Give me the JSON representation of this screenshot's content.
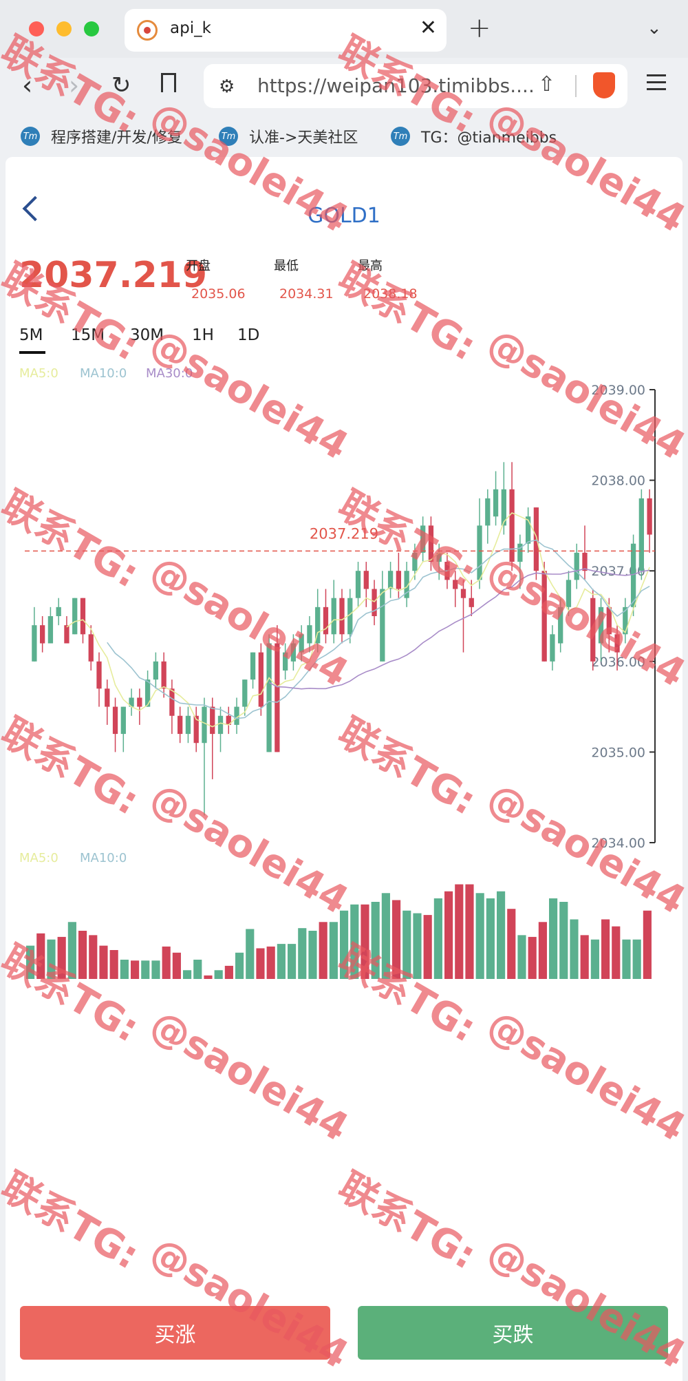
{
  "browser": {
    "tab_title": "api_k",
    "url": "https://weipan103.timibbs....",
    "bookmarks": [
      {
        "icon": "Tm",
        "label": "程序搭建/开发/修复"
      },
      {
        "icon": "Tm",
        "label": "认准->天美社区"
      },
      {
        "icon": "Tm",
        "label": "TG：@tianmeibbs"
      }
    ]
  },
  "header": {
    "symbol": "GOLD1"
  },
  "quote": {
    "last_price": "2037.219",
    "open_label": "开盘",
    "open_value": "2035.06",
    "low_label": "最低",
    "low_value": "2034.31",
    "high_label": "最高",
    "high_value": "2038.18"
  },
  "periods": [
    "5M",
    "15M",
    "30M",
    "1H",
    "1D"
  ],
  "active_period": "5M",
  "indicators": {
    "price_ma": [
      "MA5:0",
      "MA10:0",
      "MA30:0"
    ],
    "volume_ma": [
      "MA5:0",
      "MA10:0"
    ]
  },
  "colors": {
    "up": "#5bb08f",
    "down": "#d14458",
    "accent_red": "#e2554a",
    "ma5": "#e6ec9c",
    "ma10": "#9cc3d0",
    "ma30": "#a88cc8"
  },
  "chart_data": {
    "type": "candlestick",
    "y_axis_ticks": [
      "2039.00",
      "2038.00",
      "2037.00",
      "2036.00",
      "2035.00",
      "2034.00"
    ],
    "ylim": [
      2034,
      2039
    ],
    "last_price_line": {
      "value": 2037.219,
      "label": "2037.219"
    },
    "candles": [
      {
        "o": 2036.0,
        "c": 2036.4,
        "h": 2036.6,
        "l": 2036.0
      },
      {
        "o": 2036.4,
        "c": 2036.2,
        "h": 2036.5,
        "l": 2036.1
      },
      {
        "o": 2036.2,
        "c": 2036.5,
        "h": 2036.6,
        "l": 2036.2
      },
      {
        "o": 2036.5,
        "c": 2036.6,
        "h": 2036.7,
        "l": 2036.4
      },
      {
        "o": 2036.4,
        "c": 2036.2,
        "h": 2036.5,
        "l": 2036.2
      },
      {
        "o": 2036.3,
        "c": 2036.7,
        "h": 2036.7,
        "l": 2036.3
      },
      {
        "o": 2036.7,
        "c": 2036.3,
        "h": 2036.7,
        "l": 2036.2
      },
      {
        "o": 2036.3,
        "c": 2036.0,
        "h": 2036.4,
        "l": 2035.9
      },
      {
        "o": 2036.0,
        "c": 2035.7,
        "h": 2036.1,
        "l": 2035.5
      },
      {
        "o": 2035.7,
        "c": 2035.5,
        "h": 2035.8,
        "l": 2035.3
      },
      {
        "o": 2035.5,
        "c": 2035.2,
        "h": 2035.6,
        "l": 2035.0
      },
      {
        "o": 2035.2,
        "c": 2035.5,
        "h": 2035.5,
        "l": 2035.0
      },
      {
        "o": 2035.5,
        "c": 2035.6,
        "h": 2035.7,
        "l": 2035.4
      },
      {
        "o": 2035.6,
        "c": 2035.5,
        "h": 2035.7,
        "l": 2035.3
      },
      {
        "o": 2035.5,
        "c": 2035.8,
        "h": 2035.9,
        "l": 2035.5
      },
      {
        "o": 2035.8,
        "c": 2036.0,
        "h": 2036.1,
        "l": 2035.7
      },
      {
        "o": 2036.0,
        "c": 2035.7,
        "h": 2036.1,
        "l": 2035.6
      },
      {
        "o": 2035.7,
        "c": 2035.4,
        "h": 2035.8,
        "l": 2035.2
      },
      {
        "o": 2035.4,
        "c": 2035.2,
        "h": 2035.5,
        "l": 2035.1
      },
      {
        "o": 2035.2,
        "c": 2035.4,
        "h": 2035.5,
        "l": 2035.1
      },
      {
        "o": 2035.4,
        "c": 2035.1,
        "h": 2035.5,
        "l": 2035.0
      },
      {
        "o": 2035.1,
        "c": 2035.5,
        "h": 2035.6,
        "l": 2034.3
      },
      {
        "o": 2035.5,
        "c": 2035.2,
        "h": 2035.6,
        "l": 2034.7
      },
      {
        "o": 2035.2,
        "c": 2035.4,
        "h": 2035.5,
        "l": 2035.0
      },
      {
        "o": 2035.4,
        "c": 2035.3,
        "h": 2035.5,
        "l": 2035.2
      },
      {
        "o": 2035.3,
        "c": 2035.5,
        "h": 2035.6,
        "l": 2035.2
      },
      {
        "o": 2035.5,
        "c": 2035.8,
        "h": 2035.8,
        "l": 2035.4
      },
      {
        "o": 2035.8,
        "c": 2036.1,
        "h": 2036.1,
        "l": 2035.7
      },
      {
        "o": 2036.1,
        "c": 2035.5,
        "h": 2036.2,
        "l": 2035.4
      },
      {
        "o": 2035.0,
        "c": 2036.2,
        "h": 2036.3,
        "l": 2035.0
      },
      {
        "o": 2036.2,
        "c": 2035.0,
        "h": 2036.4,
        "l": 2035.0
      },
      {
        "o": 2035.9,
        "c": 2036.1,
        "h": 2036.2,
        "l": 2035.8
      },
      {
        "o": 2036.0,
        "c": 2036.2,
        "h": 2036.3,
        "l": 2035.9
      },
      {
        "o": 2036.1,
        "c": 2036.3,
        "h": 2036.4,
        "l": 2036.0
      },
      {
        "o": 2036.2,
        "c": 2036.4,
        "h": 2036.5,
        "l": 2036.1
      },
      {
        "o": 2036.2,
        "c": 2036.6,
        "h": 2036.8,
        "l": 2036.1
      },
      {
        "o": 2036.6,
        "c": 2036.3,
        "h": 2036.8,
        "l": 2036.2
      },
      {
        "o": 2036.3,
        "c": 2036.7,
        "h": 2036.9,
        "l": 2036.2
      },
      {
        "o": 2036.7,
        "c": 2036.3,
        "h": 2036.8,
        "l": 2036.2
      },
      {
        "o": 2036.3,
        "c": 2036.7,
        "h": 2036.8,
        "l": 2036.2
      },
      {
        "o": 2036.7,
        "c": 2037.0,
        "h": 2037.1,
        "l": 2036.6
      },
      {
        "o": 2037.0,
        "c": 2036.8,
        "h": 2037.1,
        "l": 2036.6
      },
      {
        "o": 2036.8,
        "c": 2036.5,
        "h": 2036.9,
        "l": 2036.4
      },
      {
        "o": 2036.0,
        "c": 2036.8,
        "h": 2037.0,
        "l": 2036.0
      },
      {
        "o": 2036.8,
        "c": 2037.0,
        "h": 2037.1,
        "l": 2036.7
      },
      {
        "o": 2037.0,
        "c": 2036.8,
        "h": 2037.2,
        "l": 2036.7
      },
      {
        "o": 2036.7,
        "c": 2037.0,
        "h": 2037.1,
        "l": 2036.6
      },
      {
        "o": 2037.0,
        "c": 2037.2,
        "h": 2037.3,
        "l": 2036.9
      },
      {
        "o": 2037.2,
        "c": 2037.5,
        "h": 2037.6,
        "l": 2037.1
      },
      {
        "o": 2037.5,
        "c": 2037.1,
        "h": 2037.6,
        "l": 2037.0
      },
      {
        "o": 2037.1,
        "c": 2037.2,
        "h": 2037.3,
        "l": 2036.9
      },
      {
        "o": 2037.1,
        "c": 2036.9,
        "h": 2037.2,
        "l": 2036.8
      },
      {
        "o": 2036.9,
        "c": 2036.8,
        "h": 2037.0,
        "l": 2036.6
      },
      {
        "o": 2036.8,
        "c": 2036.7,
        "h": 2036.9,
        "l": 2036.1
      },
      {
        "o": 2036.7,
        "c": 2036.6,
        "h": 2036.9,
        "l": 2036.5
      },
      {
        "o": 2036.9,
        "c": 2037.5,
        "h": 2037.8,
        "l": 2036.8
      },
      {
        "o": 2037.5,
        "c": 2037.8,
        "h": 2037.9,
        "l": 2037.3
      },
      {
        "o": 2037.6,
        "c": 2037.9,
        "h": 2038.1,
        "l": 2037.5
      },
      {
        "o": 2037.5,
        "c": 2037.9,
        "h": 2038.2,
        "l": 2037.4
      },
      {
        "o": 2037.9,
        "c": 2037.1,
        "h": 2038.2,
        "l": 2037.0
      },
      {
        "o": 2037.1,
        "c": 2037.3,
        "h": 2037.4,
        "l": 2036.8
      },
      {
        "o": 2037.3,
        "c": 2037.6,
        "h": 2037.7,
        "l": 2037.2
      },
      {
        "o": 2037.7,
        "c": 2037.0,
        "h": 2037.7,
        "l": 2036.9
      },
      {
        "o": 2037.0,
        "c": 2036.0,
        "h": 2037.1,
        "l": 2036.0
      },
      {
        "o": 2036.0,
        "c": 2036.3,
        "h": 2036.4,
        "l": 2035.9
      },
      {
        "o": 2036.2,
        "c": 2036.6,
        "h": 2036.7,
        "l": 2036.1
      },
      {
        "o": 2036.6,
        "c": 2036.9,
        "h": 2037.0,
        "l": 2036.5
      },
      {
        "o": 2036.9,
        "c": 2037.2,
        "h": 2037.3,
        "l": 2036.8
      },
      {
        "o": 2037.2,
        "c": 2037.0,
        "h": 2037.5,
        "l": 2036.9
      },
      {
        "o": 2036.7,
        "c": 2036.0,
        "h": 2036.8,
        "l": 2035.9
      },
      {
        "o": 2036.2,
        "c": 2036.6,
        "h": 2036.7,
        "l": 2036.0
      },
      {
        "o": 2036.6,
        "c": 2036.3,
        "h": 2036.7,
        "l": 2036.1
      },
      {
        "o": 2036.3,
        "c": 2036.1,
        "h": 2036.4,
        "l": 2035.9
      },
      {
        "o": 2036.3,
        "c": 2036.6,
        "h": 2036.7,
        "l": 2036.2
      },
      {
        "o": 2036.6,
        "c": 2037.3,
        "h": 2037.4,
        "l": 2036.5
      },
      {
        "o": 2037.0,
        "c": 2037.8,
        "h": 2037.9,
        "l": 2036.9
      },
      {
        "o": 2037.8,
        "c": 2037.4,
        "h": 2037.9,
        "l": 2037.2
      }
    ],
    "volumes": [
      38,
      52,
      45,
      48,
      65,
      55,
      50,
      38,
      33,
      22,
      21,
      21,
      21,
      37,
      30,
      10,
      22,
      4,
      10,
      15,
      30,
      57,
      35,
      37,
      40,
      40,
      58,
      55,
      65,
      65,
      78,
      85,
      85,
      88,
      98,
      90,
      78,
      75,
      73,
      92,
      100,
      108,
      108,
      98,
      92,
      100,
      80,
      50,
      48,
      65,
      92,
      88,
      68,
      50,
      45,
      68,
      60,
      45,
      45,
      78
    ]
  },
  "actions": {
    "buy_up": "买涨",
    "buy_down": "买跌"
  },
  "watermark": {
    "line1": "联系TG:",
    "line2": "@saolei44"
  }
}
